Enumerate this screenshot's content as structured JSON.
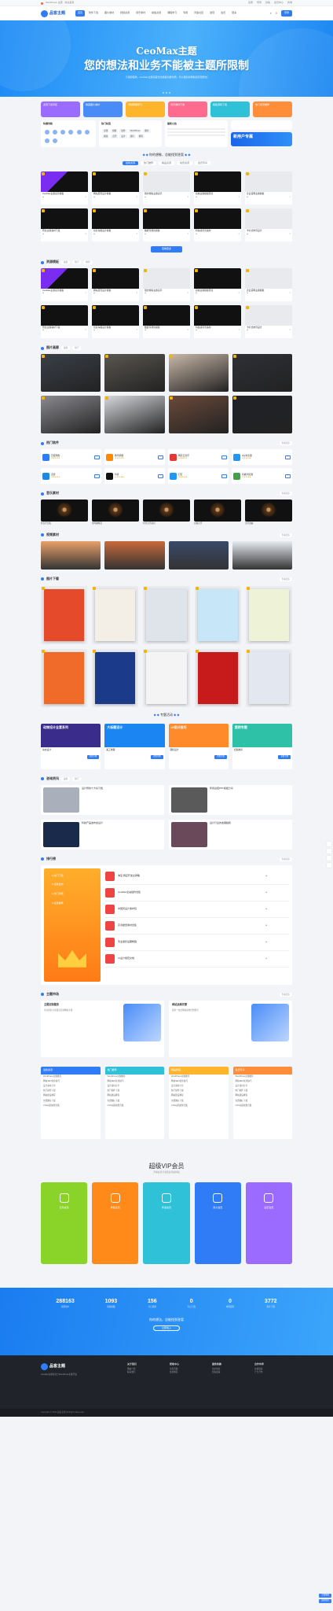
{
  "topbar": {
    "notice": "WordPress 主题 · 欢迎来到",
    "links": [
      "注册",
      "登录",
      "投稿",
      "会员中心",
      "商城"
    ]
  },
  "nav": {
    "logo": "品客主题",
    "menu": [
      "首页",
      "软件下载",
      "图片素材",
      "视频资源",
      "音乐素材",
      "模板资源",
      "课程学习",
      "专题",
      "问答社区",
      "发现",
      "会员",
      "更多"
    ],
    "cta": "登录"
  },
  "hero": {
    "line1": "CeoMax主题",
    "line2": "您的想法和业务不能被主题所限制",
    "desc": "下载即使用，CeoMax主题深度优化模板功能布局，可以更好的帮助您实现想法!"
  },
  "categories": [
    {
      "t": "资源下载专区",
      "c": "#9b6bff"
    },
    {
      "t": "精美图片素材",
      "c": "#4a8cf7"
    },
    {
      "t": "视频教程学习",
      "c": "#ffb52b"
    },
    {
      "t": "音乐素材下载",
      "c": "#ff6a8e"
    },
    {
      "t": "模板源码下载",
      "c": "#2ec1d8"
    },
    {
      "t": "热门资源推荐",
      "c": "#ff8d3a"
    }
  ],
  "quick": {
    "a": "快捷导航",
    "b": "热门标签",
    "c": "最新公告",
    "tags": [
      "主题",
      "模板",
      "插件",
      "WordPress",
      "图片",
      "视频",
      "音乐",
      "设计",
      "源码",
      "教程"
    ],
    "new": "新用户专属"
  },
  "featured": {
    "title": "你的想象，总能找到答案",
    "tabs": [
      "最新资源",
      "热门推荐",
      "精品资源",
      "免费资源",
      "会员专享"
    ],
    "more": "查看更多"
  },
  "cards": [
    {
      "t": "CeoMax主题演示模板",
      "k": "purple"
    },
    {
      "t": "网站首页设计模板",
      "k": "dark"
    },
    {
      "t": "简约博客主题演示",
      "k": "light"
    },
    {
      "t": "商城主题模板预览",
      "k": "dark"
    },
    {
      "t": "企业官网主题模板",
      "k": "light"
    },
    {
      "t": "恐龙主题素材下载",
      "k": "dark"
    },
    {
      "t": "创意海报设计模板",
      "k": "dark"
    },
    {
      "t": "数据可视化模板",
      "k": "dark"
    },
    {
      "t": "科技感背景素材",
      "k": "dark"
    },
    {
      "t": "卡片式布局设计",
      "k": "light"
    }
  ],
  "sections": {
    "resources": "资源模板",
    "images": "图片画廊",
    "apps": "热门软件",
    "music": "音乐素材",
    "video": "视频素材",
    "posters": "图片下载",
    "topics": "专题活动",
    "news": "咨询资讯",
    "rank": "排行榜",
    "service": "主题市场"
  },
  "subtabs": [
    "最新",
    "热门",
    "推荐"
  ],
  "more": "查看更多",
  "images": [
    {
      "c": "#3a4048"
    },
    {
      "c": "#5a5650"
    },
    {
      "c": "#c9b8a8"
    },
    {
      "c": "#2e3036"
    },
    {
      "c": "#8a8a90"
    },
    {
      "c": "#d6d8dc"
    },
    {
      "c": "#6b4a3a"
    },
    {
      "c": "#202228"
    }
  ],
  "apps": [
    {
      "n": "百度网盘",
      "c": "#2f7cf6"
    },
    {
      "n": "腾讯视频",
      "c": "#ff8a00"
    },
    {
      "n": "网易云音乐",
      "c": "#e53935"
    },
    {
      "n": "QQ浏览器",
      "c": "#2196f3"
    },
    {
      "n": "迅雷",
      "c": "#1e88e5"
    },
    {
      "n": "抖音",
      "c": "#111"
    },
    {
      "n": "钉钉",
      "c": "#2196f3"
    },
    {
      "n": "谷歌浏览器",
      "c": "#43a047"
    }
  ],
  "music": [
    "轻音乐合集",
    "钢琴曲精选",
    "背景音乐素材",
    "古典音乐",
    "流行歌曲"
  ],
  "videos": [
    {
      "c": "#e8a06a"
    },
    {
      "c": "#c86a3a"
    },
    {
      "c": "#3a4a6a"
    },
    {
      "c": "#e6ebf0"
    }
  ],
  "posters": [
    {
      "c": "#e54b2b"
    },
    {
      "c": "#f3efe6"
    },
    {
      "c": "#dfe3ea"
    },
    {
      "c": "#c7e6f7"
    },
    {
      "c": "#eef3d8"
    },
    {
      "c": "#f06a2a"
    },
    {
      "c": "#1b3a8a"
    },
    {
      "c": "#f4f4f4"
    },
    {
      "c": "#c71a1a"
    },
    {
      "c": "#e3e7ef"
    }
  ],
  "topics": [
    {
      "t": "动物设计全套系列",
      "c": "#3a2c8a",
      "s": "动态设计"
    },
    {
      "t": "大标题设计",
      "c": "#1b86f2",
      "s": "美工教程"
    },
    {
      "t": "UI设计技巧",
      "c": "#ff8a2a",
      "s": "图标设计"
    },
    {
      "t": "案例专题",
      "c": "#2ec1a8",
      "s": "合集推荐"
    }
  ],
  "topicbtn": "查看专题",
  "news": [
    {
      "t": "设计师的十大好习惯",
      "c": "#aab0bb"
    },
    {
      "t": "年终总结PPT模板分享",
      "c": "#5a5a5a"
    },
    {
      "t": "科技产品发布会设计",
      "c": "#1a2a4a"
    },
    {
      "t": "设计行业的发展趋势",
      "c": "#6a4a5a"
    }
  ],
  "rank": {
    "tabs": [
      "热门下载",
      "最新发布",
      "热门浏览",
      "会员推荐"
    ],
    "items": [
      "淘宝 网店开发全攻略",
      "CeoMax全站插件合集",
      "中国风设计素材包",
      "高清壁纸素材合集",
      "专业摄影后期教程",
      "UI设计规范文档"
    ]
  },
  "service": [
    {
      "t": "主题定制服务",
      "d": "专业团队为您量身定制网站主题"
    },
    {
      "t": "网站运维托管",
      "d": "提供一站式网站运维托管服务"
    }
  ],
  "cols": [
    {
      "t": "最新资源",
      "c": "#2f7cf6"
    },
    {
      "t": "热门推荐",
      "c": "#2ec1d8"
    },
    {
      "t": "精品教程",
      "c": "#ffb52b"
    },
    {
      "t": "会员专享",
      "c": "#ff8d3a"
    }
  ],
  "colitems": [
    "WordPress主题推荐",
    "网站SEO优化技巧",
    "设计素材分享",
    "热门插件下载",
    "网站建设教程",
    "免费图标下载",
    "CSS动画效果合集"
  ],
  "vip": {
    "title": "超级VIP会员",
    "sub": "开通会员享受更多专属特权",
    "cards": [
      {
        "t": "包月会员",
        "c": "#8ad42a"
      },
      {
        "t": "季度会员",
        "c": "#ff8a1a"
      },
      {
        "t": "年度会员",
        "c": "#2ec1d8"
      },
      {
        "t": "永久会员",
        "c": "#2f7cf6"
      },
      {
        "t": "钻石会员",
        "c": "#9b6bff"
      }
    ]
  },
  "stats": {
    "nums": [
      {
        "v": "288163",
        "l": "注册用户"
      },
      {
        "v": "1093",
        "l": "资源总数"
      },
      {
        "v": "156",
        "l": "今日更新"
      },
      {
        "v": "0",
        "l": "今日下载"
      },
      {
        "v": "0",
        "l": "本周更新"
      },
      {
        "v": "3772",
        "l": "累计下载"
      }
    ],
    "cta": "你的想法，总能找到答案",
    "btn": "立即加入"
  },
  "footer": {
    "logo": "品客主题",
    "desc": "CeoMax主题专注于WordPress主题开发",
    "cols": [
      {
        "t": "关于我们",
        "i": [
          "网站介绍",
          "联系我们"
        ]
      },
      {
        "t": "帮助中心",
        "i": [
          "常见问题",
          "使用教程"
        ]
      },
      {
        "t": "服务条款",
        "i": [
          "用户协议",
          "隐私政策"
        ]
      },
      {
        "t": "合作伙伴",
        "i": [
          "友情链接",
          "广告合作"
        ]
      }
    ],
    "copy": "Copyright © 2024 品客主题 All Rights Reserved"
  },
  "chat": [
    "在线客服",
    "联系我们"
  ]
}
